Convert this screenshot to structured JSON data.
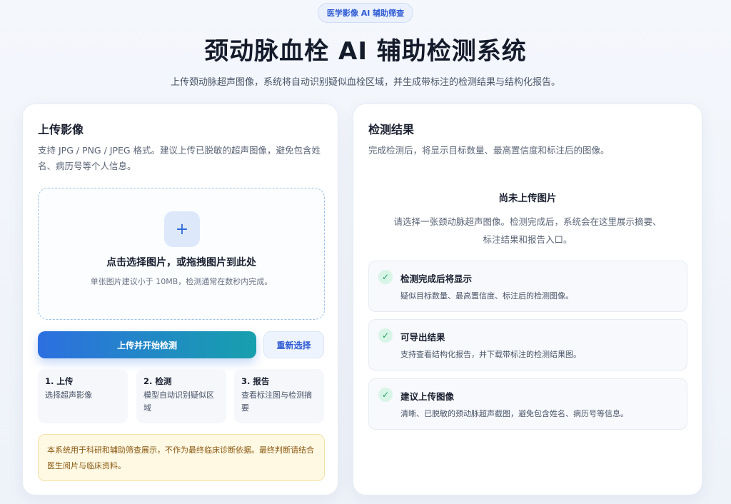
{
  "header": {
    "badge": "医学影像 AI 辅助筛查",
    "title": "颈动脉血栓 AI 辅助检测系统",
    "subtitle": "上传颈动脉超声图像，系统将自动识别疑似血栓区域，并生成带标注的检测结果与结构化报告。"
  },
  "upload": {
    "title": "上传影像",
    "desc": "支持 JPG / PNG / JPEG 格式。建议上传已脱敏的超声图像，避免包含姓名、病历号等个人信息。",
    "dropzone_icon": "plus-icon",
    "dropzone_plus": "+",
    "dropzone_title": "点击选择图片，或拖拽图片到此处",
    "dropzone_hint": "单张图片建议小于 10MB，检测通常在数秒内完成。",
    "primary_button": "上传并开始检测",
    "secondary_button": "重新选择",
    "steps": [
      {
        "title": "1. 上传",
        "desc": "选择超声影像"
      },
      {
        "title": "2. 检测",
        "desc": "模型自动识别疑似区域"
      },
      {
        "title": "3. 报告",
        "desc": "查看标注图与检测摘要"
      }
    ],
    "notice": "本系统用于科研和辅助筛查展示，不作为最终临床诊断依据。最终判断请结合医生阅片与临床资料。"
  },
  "results": {
    "title": "检测结果",
    "desc": "完成检测后，将显示目标数量、最高置信度和标注后的图像。",
    "empty_title": "尚未上传图片",
    "empty_desc": "请选择一张颈动脉超声图像。检测完成后，系统会在这里展示摘要、标注结果和报告入口。",
    "check_icon": "check-icon",
    "check_glyph": "✓",
    "items": [
      {
        "title": "检测完成后将显示",
        "desc": "疑似目标数量、最高置信度、标注后的检测图像。"
      },
      {
        "title": "可导出结果",
        "desc": "支持查看结构化报告，并下载带标注的检测结果图。"
      },
      {
        "title": "建议上传图像",
        "desc": "清晰、已脱敏的颈动脉超声截图，避免包含姓名、病历号等信息。"
      }
    ]
  },
  "colors": {
    "accent": "#2f5bd3",
    "gradient_start": "#2d6fe0",
    "gradient_end": "#17a0ad",
    "success": "#1f9d62",
    "warning_bg": "#fff8e3"
  }
}
